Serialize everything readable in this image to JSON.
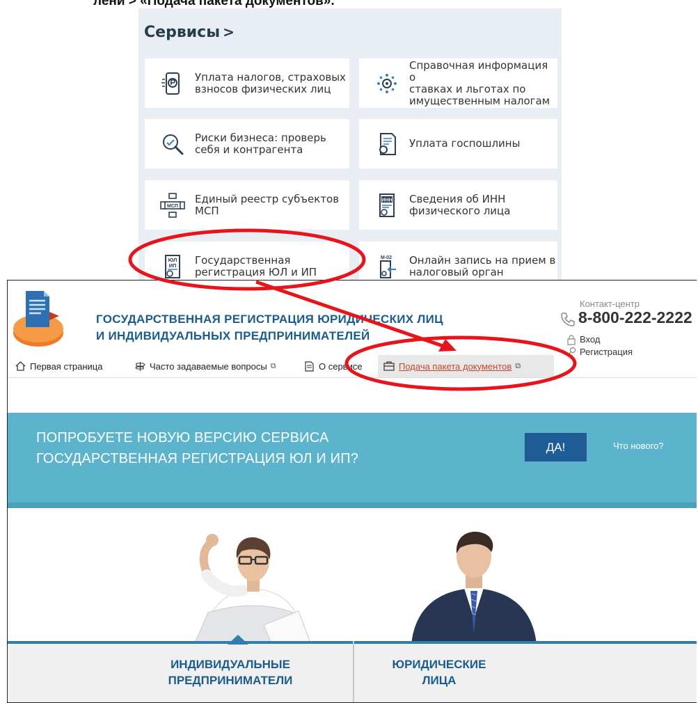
{
  "top_caption": "лени > «Подача пакета документов».",
  "services": {
    "title": "Сервисы",
    "title_chevron": ">",
    "tiles": [
      {
        "line1": "Уплата налогов, страховых",
        "line2": "взносов физических лиц",
        "line3": "",
        "icon": "tax-payment-icon"
      },
      {
        "line1": "Справочная информация о",
        "line2": "ставках и льготах по",
        "line3": "имущественным налогам",
        "icon": "tax-rates-icon"
      },
      {
        "line1": "Риски бизнеса: проверь",
        "line2": "себя и контрагента",
        "line3": "",
        "icon": "business-risk-icon"
      },
      {
        "line1": "Уплата госпошлины",
        "line2": "",
        "line3": "",
        "icon": "state-duty-icon"
      },
      {
        "line1": "Единый реестр субъектов",
        "line2": "МСП",
        "line3": "",
        "icon": "msp-registry-icon"
      },
      {
        "line1": "Сведения об ИНН",
        "line2": "физического лица",
        "line3": "",
        "icon": "inn-info-icon"
      },
      {
        "line1": "Государственная",
        "line2": "регистрация ЮЛ и ИП",
        "line3": "",
        "icon": "ul-ip-registration-icon"
      },
      {
        "line1": "Онлайн запись на прием в",
        "line2": "налоговый орган",
        "line3": "",
        "icon": "online-appointment-icon"
      }
    ],
    "icon_labels": {
      "msp": "МСП",
      "inn": "ИНН",
      "ul": "ЮЛ",
      "ip": "ИП",
      "m02": "М-02"
    }
  },
  "site": {
    "title_line1": "ГОСУДАРСТВЕННАЯ РЕГИСТРАЦИЯ ЮРИДИЧЕСКИХ ЛИЦ",
    "title_line2": "И ИНДИВИДУАЛЬНЫХ ПРЕДПРИНИМАТЕЛЕЙ",
    "contact_label": "Контакт-центр",
    "phone": "8-800-222-2222",
    "login": "Вход",
    "register": "Регистрация",
    "nav": [
      {
        "label": "Первая страница",
        "icon": "home-icon"
      },
      {
        "label": "Часто задаваемые вопросы",
        "icon": "signpost-icon"
      },
      {
        "label": "О сервисе",
        "icon": "document-icon"
      },
      {
        "label": "Подача пакета документов",
        "icon": "briefcase-icon"
      }
    ],
    "external_glyph": "⧉",
    "banner": {
      "line1": "ПОПРОБУЕТЕ НОВУЮ ВЕРСИЮ СЕРВИСА",
      "line2": "ГОСУДАРСТВЕННАЯ РЕГИСТРАЦИЯ ЮЛ И ИП?",
      "button": "ДА!",
      "link": "Что нового?"
    },
    "categories": [
      {
        "line1": "ИНДИВИДУАЛЬНЫЕ",
        "line2": "ПРЕДПРИНИМАТЕЛИ"
      },
      {
        "line1": "ЮРИДИЧЕСКИЕ",
        "line2": "ЛИЦА"
      }
    ]
  },
  "colors": {
    "annotation": "#e8141b",
    "brand_blue": "#1a5c8e",
    "banner": "#5cb3cc",
    "button": "#1f5b96",
    "active_link": "#c7462a"
  }
}
